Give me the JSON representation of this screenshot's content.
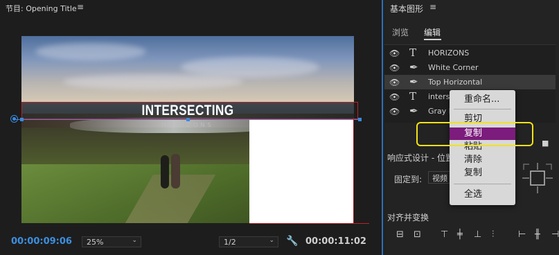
{
  "monitor": {
    "title": "节目: Opening Title",
    "menu_icon": "hamburger-icon",
    "title_text": "INTERSECTING",
    "subtitle_text": "HORIZONS",
    "current_timecode": "00:00:09:06",
    "zoom": "25%",
    "resolution": "1/2",
    "duration_timecode": "00:00:11:02"
  },
  "panel": {
    "title": "基本图形",
    "tabs": [
      {
        "label": "浏览",
        "active": false
      },
      {
        "label": "编辑",
        "active": true
      }
    ],
    "layers": [
      {
        "name": "HORIZONS",
        "type": "text",
        "selected": false
      },
      {
        "name": "White Corner",
        "type": "shape",
        "selected": false
      },
      {
        "name": "Top Horizontal",
        "type": "shape",
        "selected": true
      },
      {
        "name": "interse",
        "type": "text",
        "selected": false
      },
      {
        "name": "Gray B",
        "type": "shape",
        "selected": false
      }
    ],
    "responsive_label": "响应式设计 - 位置",
    "pin_label": "固定到:",
    "pin_value": "视频",
    "align_label": "对齐并变换"
  },
  "context_menu": {
    "items": [
      "重命名...",
      "剪切",
      "复制",
      "粘贴",
      "清除",
      "复制",
      "全选"
    ],
    "highlighted_index": 2,
    "highlight_color": "#7c1c7c"
  },
  "colors": {
    "accent": "#3c8fe0",
    "callout": "#f2e21a",
    "guide_red": "#c0202a"
  }
}
